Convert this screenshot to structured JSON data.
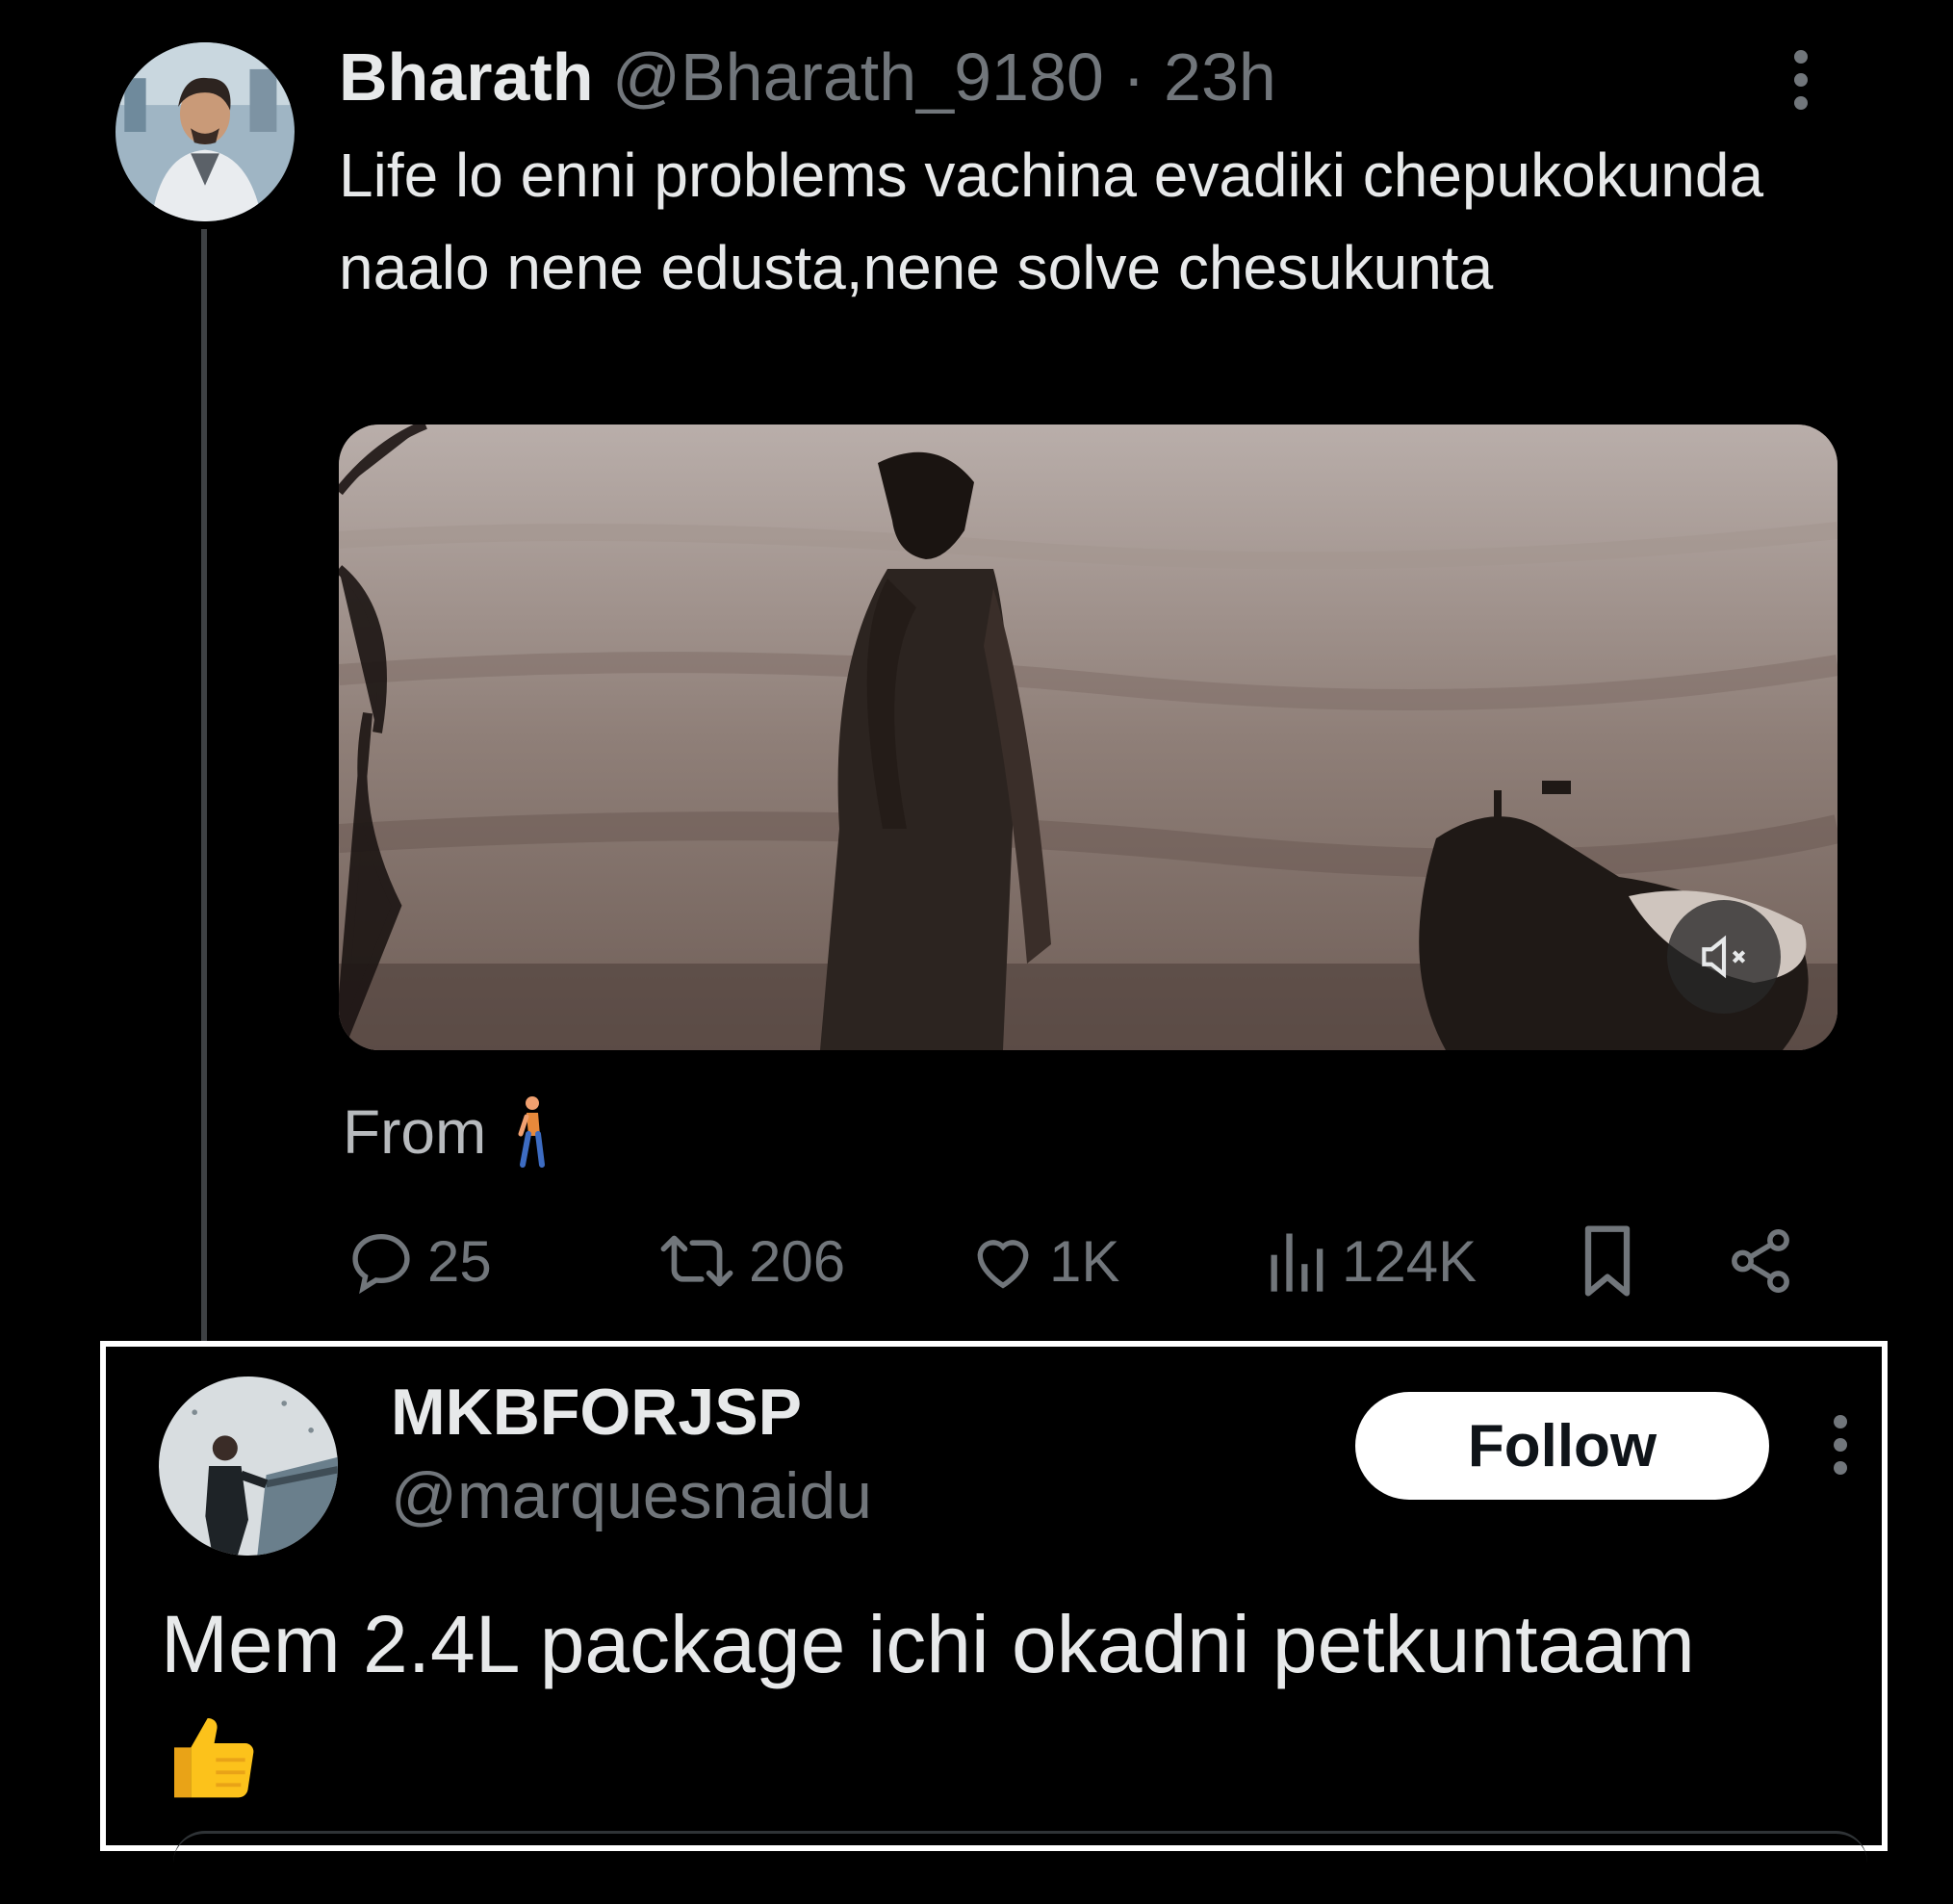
{
  "tweet": {
    "author_name": "Bharath",
    "author_handle": "@Bharath_9180",
    "separator": "·",
    "time": "23h",
    "text": "Life lo enni problems vachina evadiki chepukokunda naalo nene edusta,nene solve chesukunta",
    "media": {
      "type": "video",
      "muted": true,
      "mute_icon": "speaker-muted-icon"
    },
    "from_label": "From",
    "from_emoji": "person-walking-icon",
    "stats": {
      "replies": "25",
      "reposts": "206",
      "likes": "1K",
      "views": "124K"
    }
  },
  "reply": {
    "author_name": "MKBFORJSP",
    "author_handle": "@marquesnaidu",
    "follow_label": "Follow",
    "text": "Mem 2.4L package ichi okadni petkuntaam",
    "emoji": "thumbs-up-icon"
  },
  "colors": {
    "background": "#000000",
    "primary_text": "#e7e9ea",
    "secondary_text": "#71767b",
    "highlight_border": "#ffffff",
    "follow_button_bg": "#ffffff"
  }
}
